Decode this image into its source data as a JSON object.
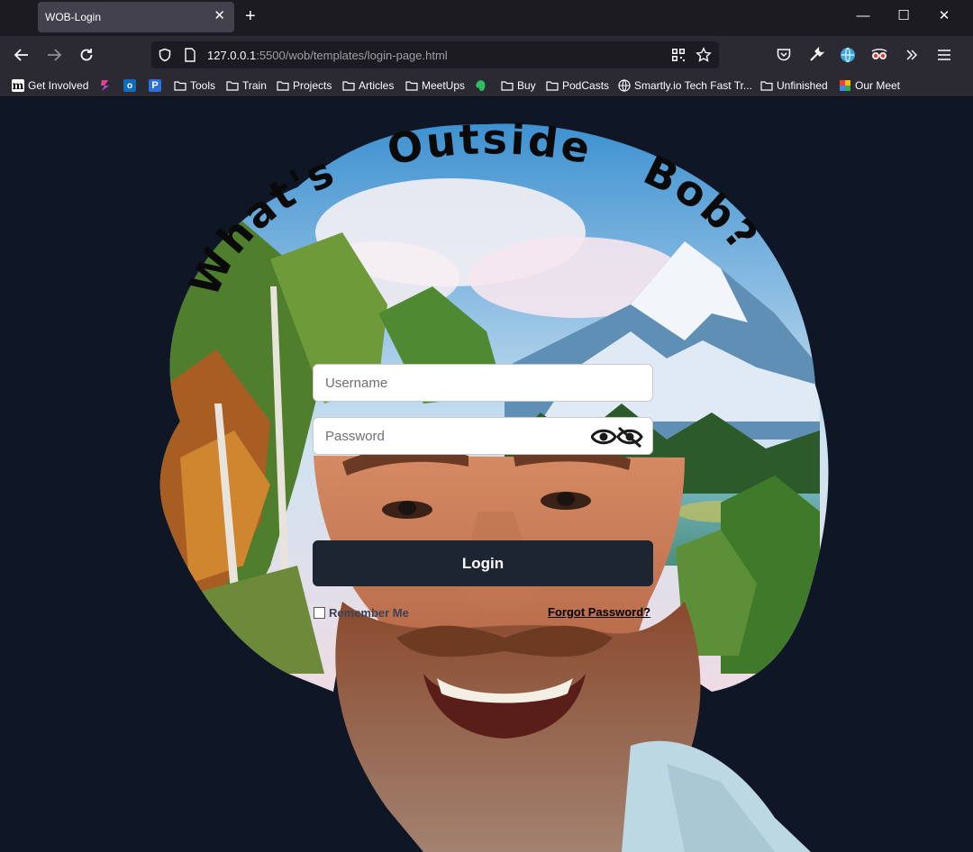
{
  "browser": {
    "tab_title": "WOB-Login",
    "url_host": "127.0.0.1",
    "url_rest": ":5500/wob/templates/login-page.html",
    "window_controls": [
      "minimize-icon",
      "maximize-icon",
      "close-icon"
    ]
  },
  "bookmarks": [
    {
      "label": "Get Involved",
      "icon": "m-logo-icon"
    },
    {
      "label": "",
      "icon": "app-icon"
    },
    {
      "label": "",
      "icon": "outlook-icon"
    },
    {
      "label": "",
      "icon": "p-icon"
    },
    {
      "label": "Tools",
      "icon": "folder-icon"
    },
    {
      "label": "Train",
      "icon": "folder-icon"
    },
    {
      "label": "Projects",
      "icon": "folder-icon"
    },
    {
      "label": "Articles",
      "icon": "folder-icon"
    },
    {
      "label": "MeetUps",
      "icon": "folder-icon"
    },
    {
      "label": "",
      "icon": "evernote-icon"
    },
    {
      "label": "Buy",
      "icon": "folder-icon"
    },
    {
      "label": "PodCasts",
      "icon": "folder-icon"
    },
    {
      "label": "Smartly.io Tech Fast Tr...",
      "icon": "globe-icon"
    },
    {
      "label": "Unfinished",
      "icon": "folder-icon"
    },
    {
      "label": "Our Meet",
      "icon": "meet-icon"
    }
  ],
  "page": {
    "title_words": [
      "What's",
      "Outside",
      "Bob?"
    ],
    "username_placeholder": "Username",
    "password_placeholder": "Password",
    "login_label": "Login",
    "remember_label": "Remember Me",
    "forgot_label": "Forgot Password?"
  },
  "colors": {
    "page_bg": "#0f1626",
    "login_button": "#1d2533"
  }
}
